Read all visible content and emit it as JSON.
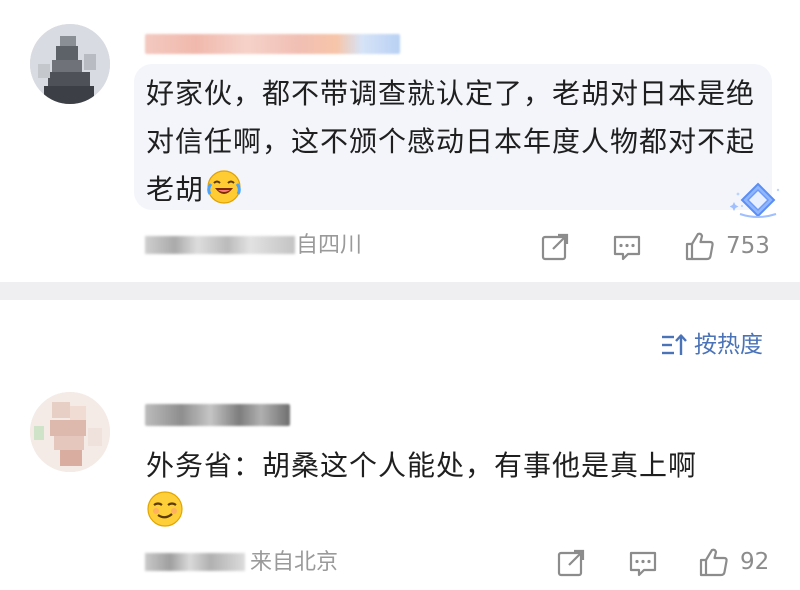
{
  "comments": [
    {
      "text": "好家伙，都不带调查就认定了，老胡对日本是绝对信任啊，这不颁个感动日本年度人物都对不起老胡",
      "trailing_emoji": "laughing-crying-emoji",
      "location": "自四川",
      "like_count": "753"
    },
    {
      "text": "外务省：胡桑这个人能处，有事他是真上啊",
      "trailing_emoji": "smirk-emoji",
      "location": "来自北京",
      "like_count": "92"
    }
  ],
  "sort": {
    "label": "按热度"
  },
  "colors": {
    "bubble": "#f3f5fb",
    "divider": "#efeff1",
    "sort_accent": "#4a73b8",
    "meta_gray": "#9a9a9a"
  }
}
